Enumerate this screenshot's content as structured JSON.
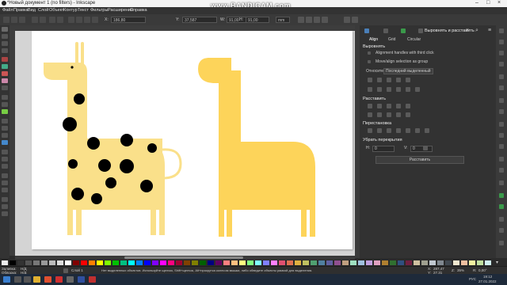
{
  "window": {
    "title": "*Новый документ 1 (no filters) - Inkscape",
    "watermark": "www.BANDICAM.com"
  },
  "menu": [
    "Файл",
    "Правка",
    "Вид",
    "Слой",
    "Объект",
    "Контур",
    "Текст",
    "Фильтры",
    "Расширения",
    "Справка"
  ],
  "toolbar": {
    "x_value": "186,80",
    "y_value": "37,587",
    "w_value": "91,00",
    "h_value": "91,00",
    "unit": "mm"
  },
  "panel": {
    "tab_title": "Выровнять и расставить",
    "subtabs": [
      "Align",
      "Grid",
      "Circular"
    ],
    "align_heading": "Выровнять",
    "checkbox_1": "Alignment handles with third click",
    "checkbox_2": "Move/align selection as group",
    "relative_label": "Относительно:",
    "relative_value": "Последний выделенный",
    "distribute_heading": "Расставить",
    "rearrange_heading": "Перестановка",
    "remove_overlap_heading": "Убрать перекрытия",
    "h_label": "H:",
    "h_value": "0",
    "v_label": "V:",
    "v_value": "0",
    "apply_button": "Расставить"
  },
  "status": {
    "fill_label": "Заливка:",
    "fill_value": "Н/Д",
    "stroke_label": "Обводка:",
    "stroke_value": "Н/Д",
    "layer": "Слой 1",
    "message": "Нет выделенных объектов. Используйте щелчок, Shift+щелчок, Alt+прокрутка колесом мышки, либо обведите объекты рамкой для выделения.",
    "x_coord": "287,47",
    "y_coord": "27,31",
    "zoom": "35%",
    "rotation": "0,00°"
  },
  "taskbar": {
    "time": "19:12",
    "date": "27.01.2022",
    "lang": "РУС"
  },
  "colors": {
    "giraffe_light": "#fae08a",
    "giraffe_yellow": "#fdd45a",
    "spots": "#000000"
  }
}
